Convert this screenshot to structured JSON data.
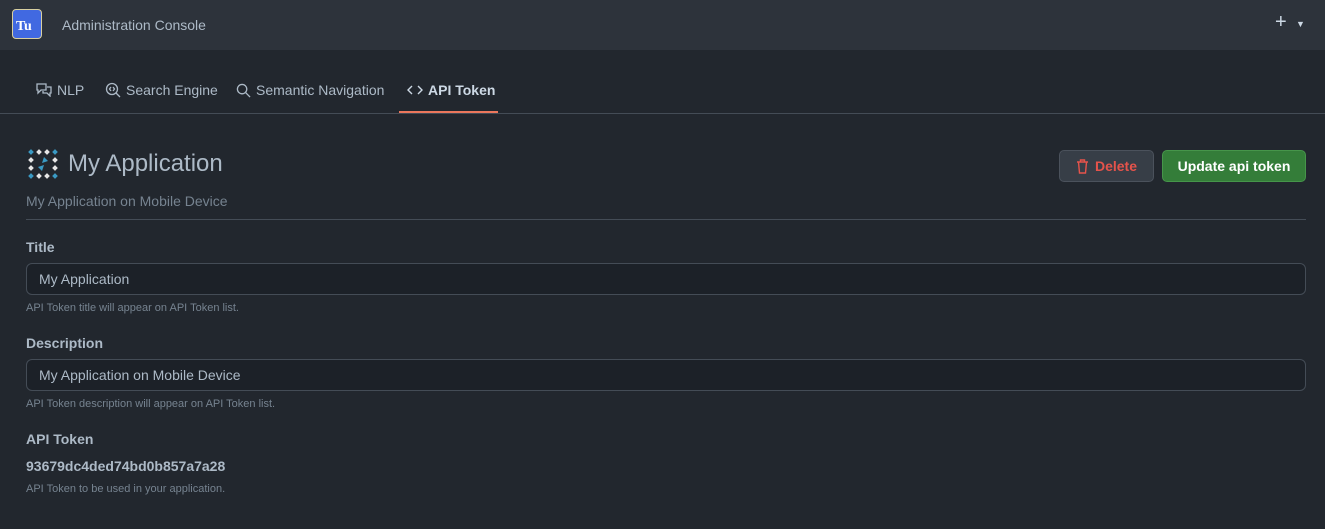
{
  "header": {
    "logo_text": "Tu",
    "title": "Administration Console",
    "plus_icon": "plus-icon",
    "caret_icon": "caret-down-icon"
  },
  "tabs": [
    {
      "label": "NLP",
      "icon": "chat-icon"
    },
    {
      "label": "Search Engine",
      "icon": "search-code-icon"
    },
    {
      "label": "Semantic Navigation",
      "icon": "search-icon"
    },
    {
      "label": "API Token",
      "icon": "code-icon",
      "active": true
    }
  ],
  "page": {
    "title": "My Application",
    "subtitle": "My Application on Mobile Device",
    "delete_label": "Delete",
    "update_label": "Update api token"
  },
  "form": {
    "title_label": "Title",
    "title_value": "My Application",
    "title_help": "API Token title will appear on API Token list.",
    "desc_label": "Description",
    "desc_value": "My Application on Mobile Device",
    "desc_help": "API Token description will appear on API Token list.",
    "token_label": "API Token",
    "token_value": "93679dc4ded74bd0b857a7a28",
    "token_help": "API Token to be used in your application."
  },
  "colors": {
    "accent": "#ec775c",
    "primary": "#347d39",
    "danger": "#e5534b",
    "background": "#22272e"
  }
}
